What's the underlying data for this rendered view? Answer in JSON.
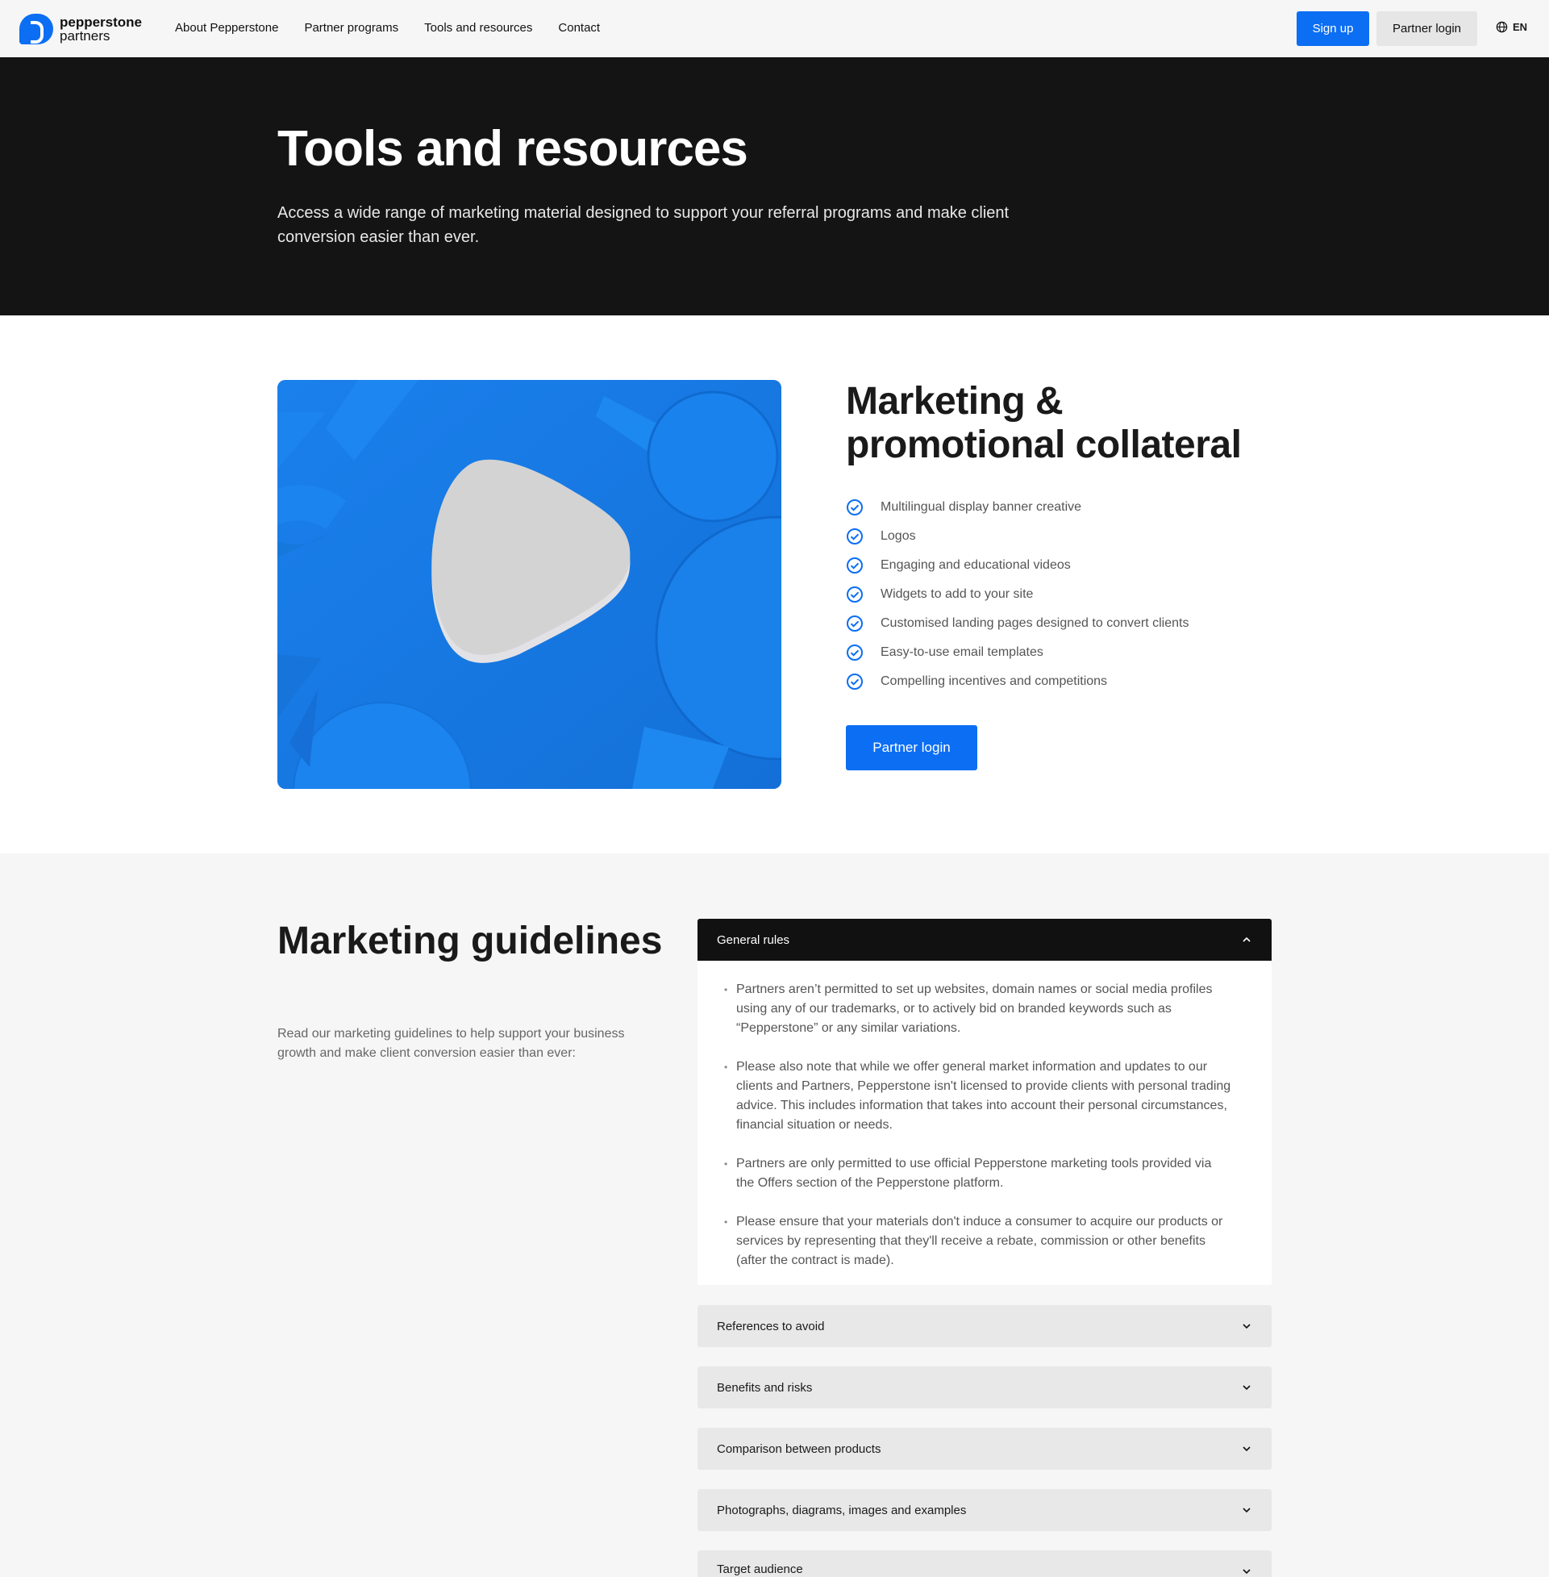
{
  "header": {
    "logo_line1": "pepperstone",
    "logo_line2": "partners",
    "nav": [
      "About Pepperstone",
      "Partner programs",
      "Tools and resources",
      "Contact"
    ],
    "signup_label": "Sign up",
    "partner_login_label": "Partner login",
    "lang_label": "EN"
  },
  "hero": {
    "title": "Tools and resources",
    "description": "Access a wide range of marketing material designed to support your referral programs and make client conversion easier than ever."
  },
  "collateral": {
    "title": "Marketing & promotional collateral",
    "items": [
      "Multilingual display banner creative",
      "Logos",
      "Engaging and educational videos",
      "Widgets to add to your site",
      "Customised landing pages designed to convert clients",
      "Easy-to-use email templates",
      "Compelling incentives and competitions"
    ],
    "button_label": "Partner login"
  },
  "guidelines": {
    "title": "Marketing guidelines",
    "description": "Read our marketing guidelines to help support your business growth and make client conversion easier than ever:",
    "open_section": {
      "title": "General rules",
      "bullets": [
        "Partners aren’t permitted to set up websites, domain names or social media profiles using any of our trademarks, or to actively bid on branded keywords such as “Pepperstone” or any similar variations.",
        "Please also note that while we offer general market information and updates to our clients and Partners, Pepperstone isn't licensed to provide clients with personal trading advice. This includes information that takes into account their personal circumstances, financial situation or needs.",
        "Partners are only permitted to use official Pepperstone marketing tools provided via the Offers section of the Pepperstone platform.",
        "Please ensure that your materials don't induce a consumer to acquire our products or services by representing that they'll receive a rebate, commission or other benefits (after the contract is made)."
      ]
    },
    "collapsed_sections": [
      "References to avoid",
      "Benefits and risks",
      "Comparison between products",
      "Photographs, diagrams, images and examples",
      "Target audience"
    ]
  },
  "colors": {
    "brand_blue": "#0c6ef3",
    "hero_bg": "#141414",
    "accordion_open": "#111111"
  },
  "icons": {
    "check": "check-circle-icon",
    "globe": "globe-icon",
    "chevron_up": "chevron-up-icon",
    "chevron_down": "chevron-down-icon"
  }
}
